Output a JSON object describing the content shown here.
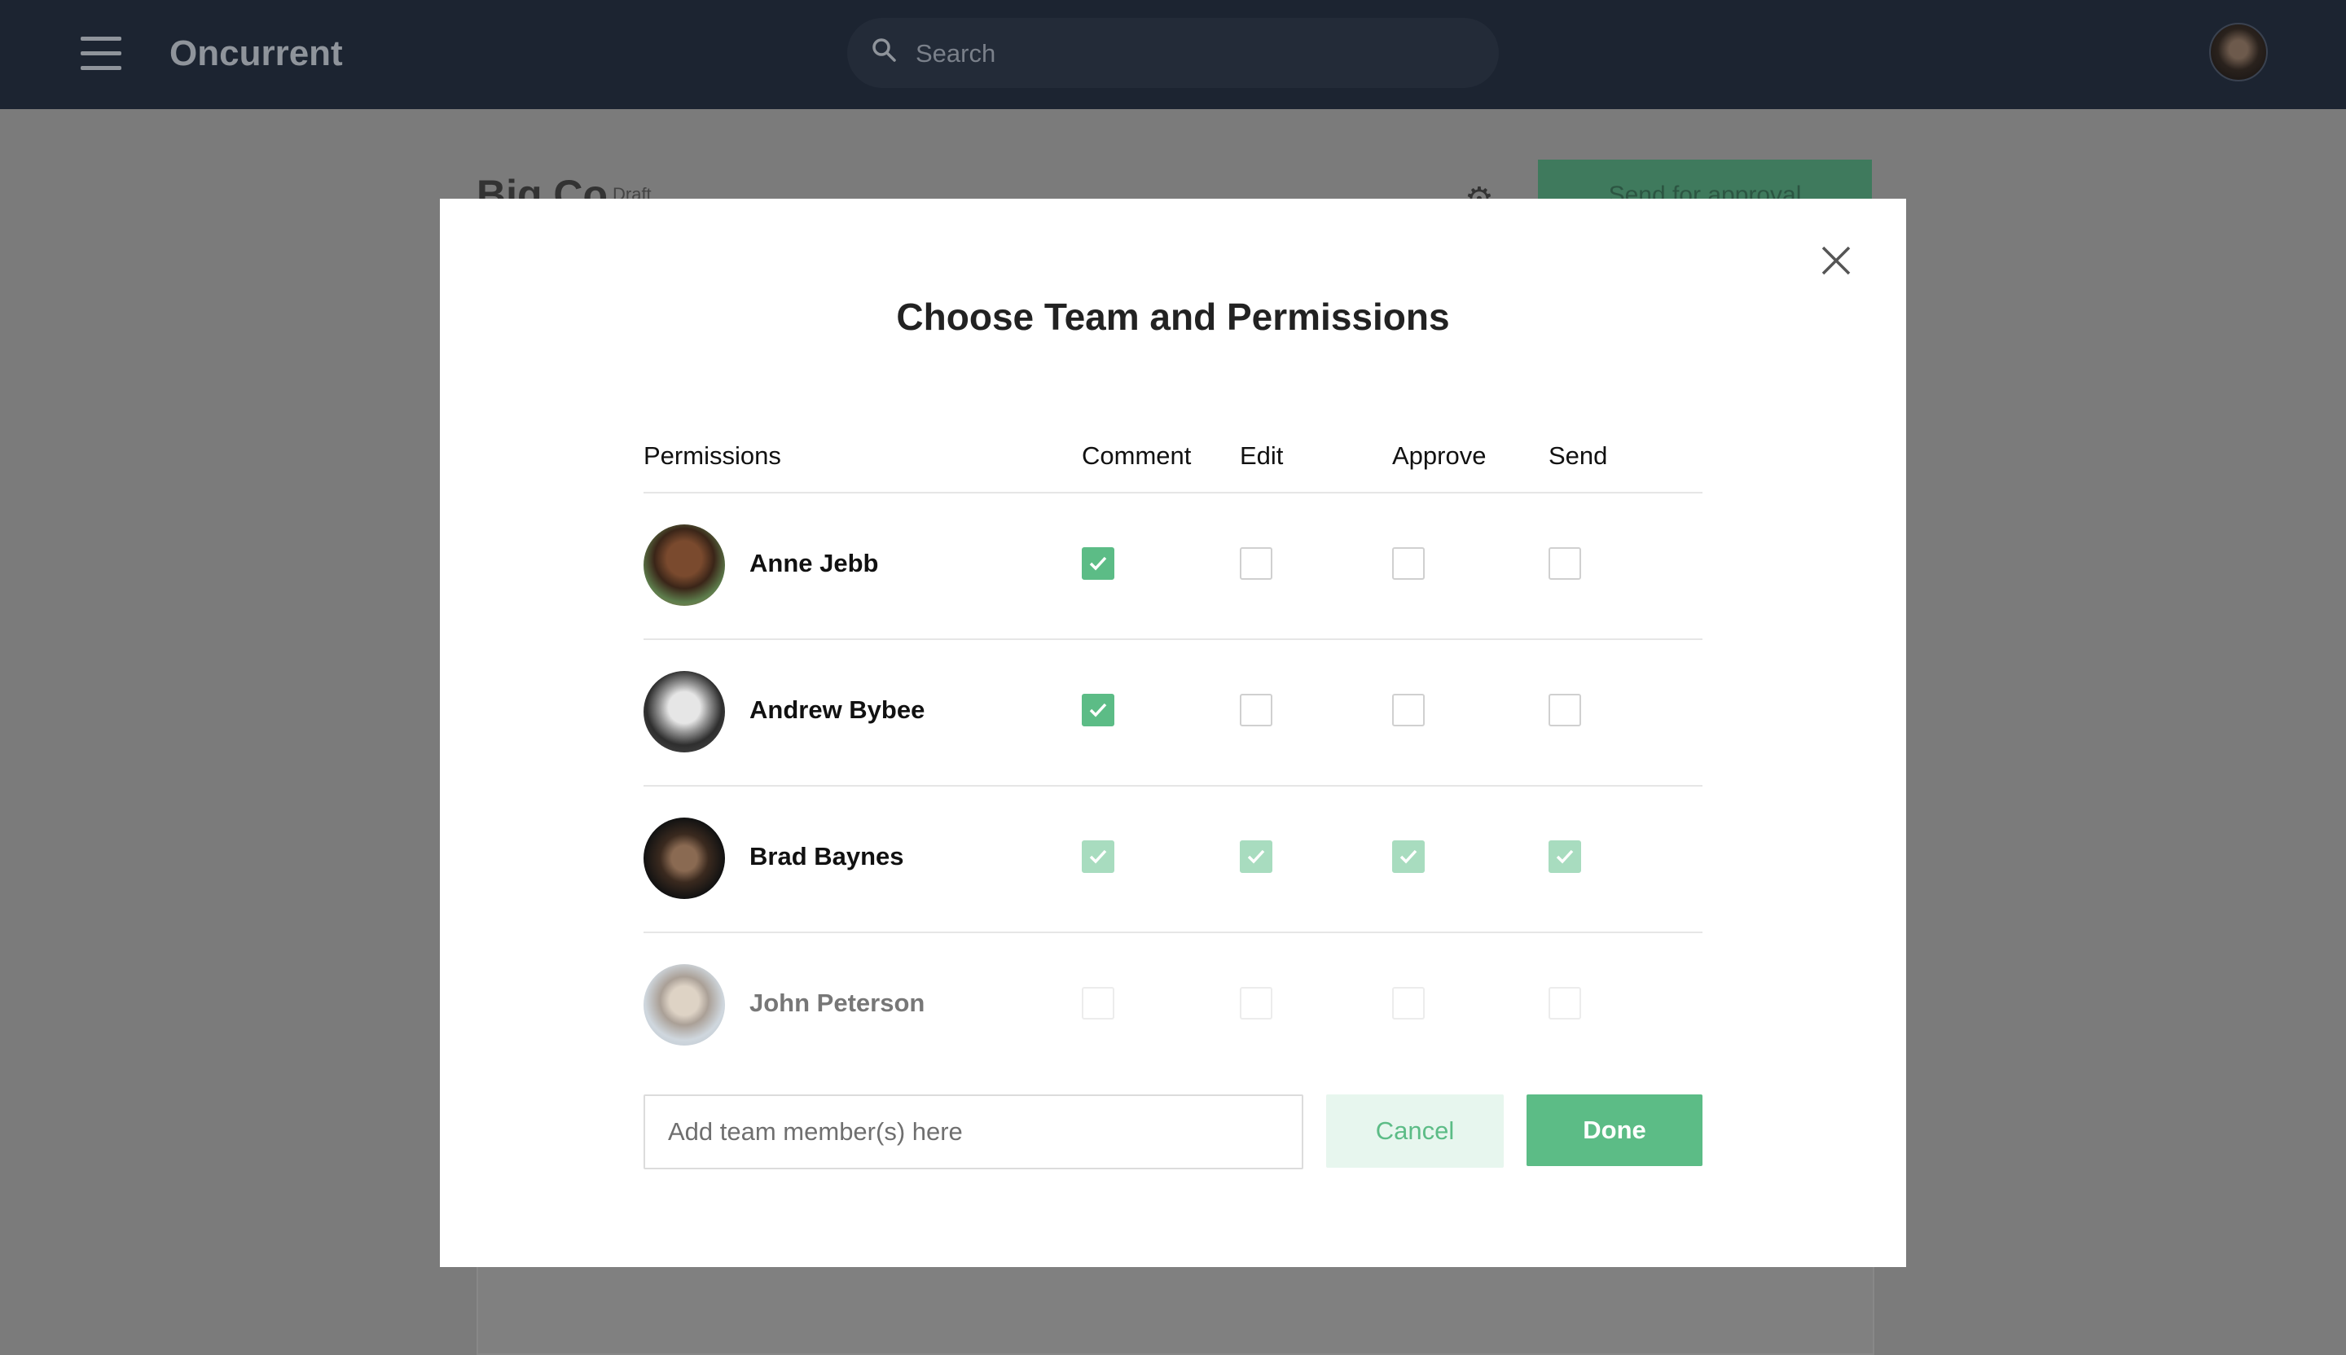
{
  "app": {
    "brand": "Oncurrent",
    "search_placeholder": "Search"
  },
  "background_page": {
    "title": "Big Co",
    "status_badge": "Draft",
    "primary_action": "Send for approval"
  },
  "modal": {
    "title": "Choose Team and Permissions",
    "columns": {
      "permissions": "Permissions",
      "comment": "Comment",
      "edit": "Edit",
      "approve": "Approve",
      "send": "Send"
    },
    "members": [
      {
        "name": "Anne Jebb",
        "comment": true,
        "edit": false,
        "approve": false,
        "send": false,
        "state": "active"
      },
      {
        "name": "Andrew Bybee",
        "comment": true,
        "edit": false,
        "approve": false,
        "send": false,
        "state": "active"
      },
      {
        "name": "Brad Baynes",
        "comment": true,
        "edit": true,
        "approve": true,
        "send": true,
        "state": "locked"
      },
      {
        "name": "John Peterson",
        "comment": false,
        "edit": false,
        "approve": false,
        "send": false,
        "state": "inactive"
      }
    ],
    "add_member_placeholder": "Add team member(s) here",
    "cancel_label": "Cancel",
    "done_label": "Done"
  },
  "colors": {
    "topbar": "#1c2431",
    "accent": "#5cbc86",
    "accent_light": "#a8dcbf",
    "cancel_bg": "#e7f6ee"
  }
}
